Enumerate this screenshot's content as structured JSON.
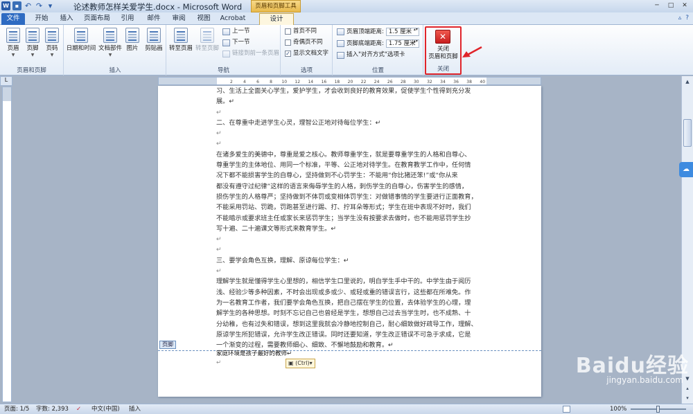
{
  "titlebar": {
    "app_icon": "W",
    "title": "论述教师怎样关爱学生.docx - Microsoft Word",
    "context_tab_group": "页眉和页脚工具",
    "window_buttons": [
      "─",
      "□",
      "✕"
    ]
  },
  "tabs": {
    "file": "文件",
    "items": [
      "开始",
      "插入",
      "页面布局",
      "引用",
      "邮件",
      "审阅",
      "视图",
      "Acrobat"
    ],
    "active": "设计"
  },
  "ribbon": {
    "hf_group": {
      "header": "页眉",
      "footer": "页脚",
      "page_number": "页码",
      "label": "页眉和页脚"
    },
    "insert_group": {
      "datetime": "日期和时间",
      "parts": "文档部件",
      "picture": "图片",
      "clipart": "剪贴画",
      "label": "插入"
    },
    "nav_group": {
      "goto_header": "转至页眉",
      "goto_footer": "转至页脚",
      "prev": "上一节",
      "next": "下一节",
      "link_prev": "链接到前一条页眉",
      "label": "导航"
    },
    "options_group": {
      "first_page": "首页不同",
      "odd_even": "奇偶页不同",
      "show_text": "显示文档文字",
      "label": "选项"
    },
    "position_group": {
      "header_dist_label": "页眉顶端距离:",
      "header_dist_value": "1.5 厘米",
      "footer_dist_label": "页脚底端距离:",
      "footer_dist_value": "1.75 厘米",
      "insert_align_tab": "插入\"对齐方式\"选项卡",
      "label": "位置"
    },
    "close_group": {
      "close_line1": "关闭",
      "close_line2": "页眉和页脚",
      "label": "关闭"
    }
  },
  "ruler": {
    "ticks": [
      "8",
      "6",
      "4",
      "2",
      "",
      "2",
      "4",
      "6",
      "8",
      "10",
      "12",
      "14",
      "16",
      "18",
      "20",
      "22",
      "24",
      "26",
      "28",
      "30",
      "32",
      "34",
      "36",
      "38",
      "40",
      "42",
      "44",
      "46",
      "48"
    ]
  },
  "document": {
    "lines": [
      "习、生活上全面关心学生，爱护学生，才会收到良好的教育效果，促使学生个性得到充分发",
      "展。↵",
      "↵",
      "二、在尊重中走进学生心灵，理智公正地对待每位学生：↵",
      "↵",
      "↵",
      "在诸多爱生的美德中，尊重是爱之核心。教师尊重学生，就是要尊重学生的人格和自尊心、",
      "尊重学生的主体地位、用同一个标准，平等、公正地对待学生。在教育教学工作中，任何情",
      "况下都不能损害学生的自尊心，坚持做到不心罚学生：不能用“你比猪还笨!”或“你从来",
      "都没有遵守过纪律”这样的语言来侮辱学生的人格，刺伤学生的自尊心，伤害学生的感情，",
      "损伤学生的人格尊严；坚持做到不体罚或变相体罚学生：对做错事情的学生要进行正面教育，",
      "不能采用罚站、罚跪，罚跑甚至进行踢、打、拧耳朵等形式；学生在班中表现不好时，我们",
      "不能暗示或要求班主任或家长来惩罚学生；当学生没有按要求去做时，也不能用惩罚学生抄",
      "写十遍、二十遍课文等形式来教育学生。↵",
      "↵",
      "↵",
      "三、要学会角色互换，理解、原谅每位学生：↵",
      "↵",
      "理解学生就是懂得学生心里想的，相信学生口里说的，明白学生手中干的。中学生由于阅历",
      "浅、经验少等多种因素，不时会出现或多或少、或轻或重的错误言行，这些都在所难免。作",
      "为一名教育工作者，我们要学会角色互换，把自己摆在学生的位置，去体验学生的心理，理",
      "解学生的各种思想。时刻不忘记自己也曾经是学生，想想自己过去当学生时，也不成熟、十",
      "分幼稚，也有过失和错误，想到这里我就会冷静地控制自己，耐心细致做好疏导工作，理解、",
      "原谅学生所犯错误，允许学生改正错误。同时还要知道，学生改正错误不可急于求成，它是",
      "一个渐变的过程，需要教师细心、细致、不懈地鼓励和教育。↵"
    ],
    "footer_tag": "页脚",
    "footer_text": "家庭环境是孩子最好的教师↵",
    "footer_mark": "↵",
    "paste_options": "(Ctrl)▾"
  },
  "status": {
    "page": "页面: 1/5",
    "words": "字数: 2,393",
    "language": "中文(中国)",
    "mode": "插入",
    "zoom": "100%",
    "zoom_fraction": 0.5
  },
  "watermark": {
    "text": "Baidu经验",
    "url": "jingyan.baidu.com"
  },
  "colors": {
    "accent": "#2e6bc2",
    "highlight_box": "#e0242a",
    "context_tab": "#e8b94c"
  }
}
